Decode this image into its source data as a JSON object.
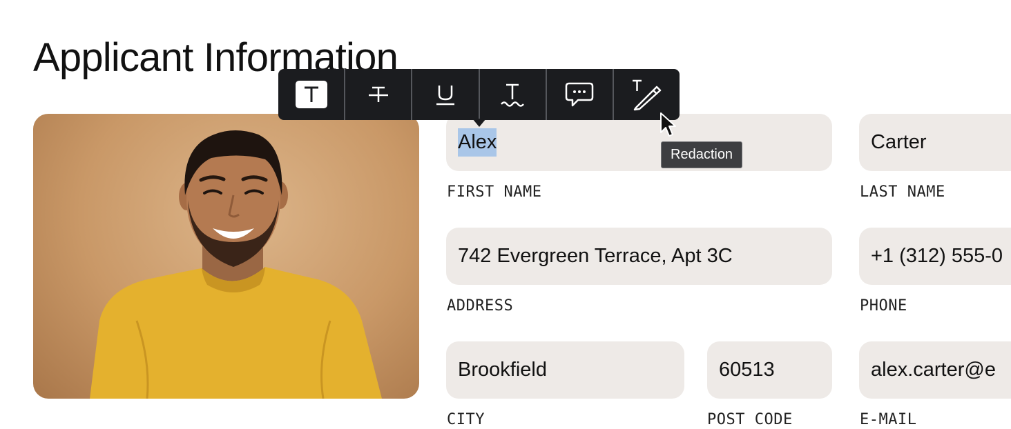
{
  "page": {
    "title": "Applicant Information"
  },
  "form": {
    "first_name": {
      "value": "Alex",
      "label": "FIRST NAME"
    },
    "last_name": {
      "value": "Carter",
      "label": "LAST NAME"
    },
    "address": {
      "value": "742 Evergreen Terrace, Apt 3C",
      "label": "ADDRESS"
    },
    "phone": {
      "value": "+1 (312) 555-0",
      "label": "PHONE"
    },
    "city": {
      "value": "Brookfield",
      "label": "CITY"
    },
    "post_code": {
      "value": "60513",
      "label": "POST CODE"
    },
    "email": {
      "value": "alex.carter@e",
      "label": "E-MAIL"
    }
  },
  "toolbar": {
    "buttons": [
      {
        "icon": "text-highlight-icon",
        "active": true
      },
      {
        "icon": "strikethrough-icon",
        "active": false
      },
      {
        "icon": "underline-icon",
        "active": false
      },
      {
        "icon": "squiggly-underline-icon",
        "active": false
      },
      {
        "icon": "comment-icon",
        "active": false
      },
      {
        "icon": "redaction-icon",
        "active": false
      }
    ],
    "tooltip": "Redaction"
  },
  "colors": {
    "field_bg": "#eeeae7",
    "selection": "#a9c6e8",
    "toolbar_bg": "#1b1c1f",
    "tooltip_bg": "#3d3e41",
    "shirt": "#e4b12e",
    "photo_bg": "#c99867"
  }
}
